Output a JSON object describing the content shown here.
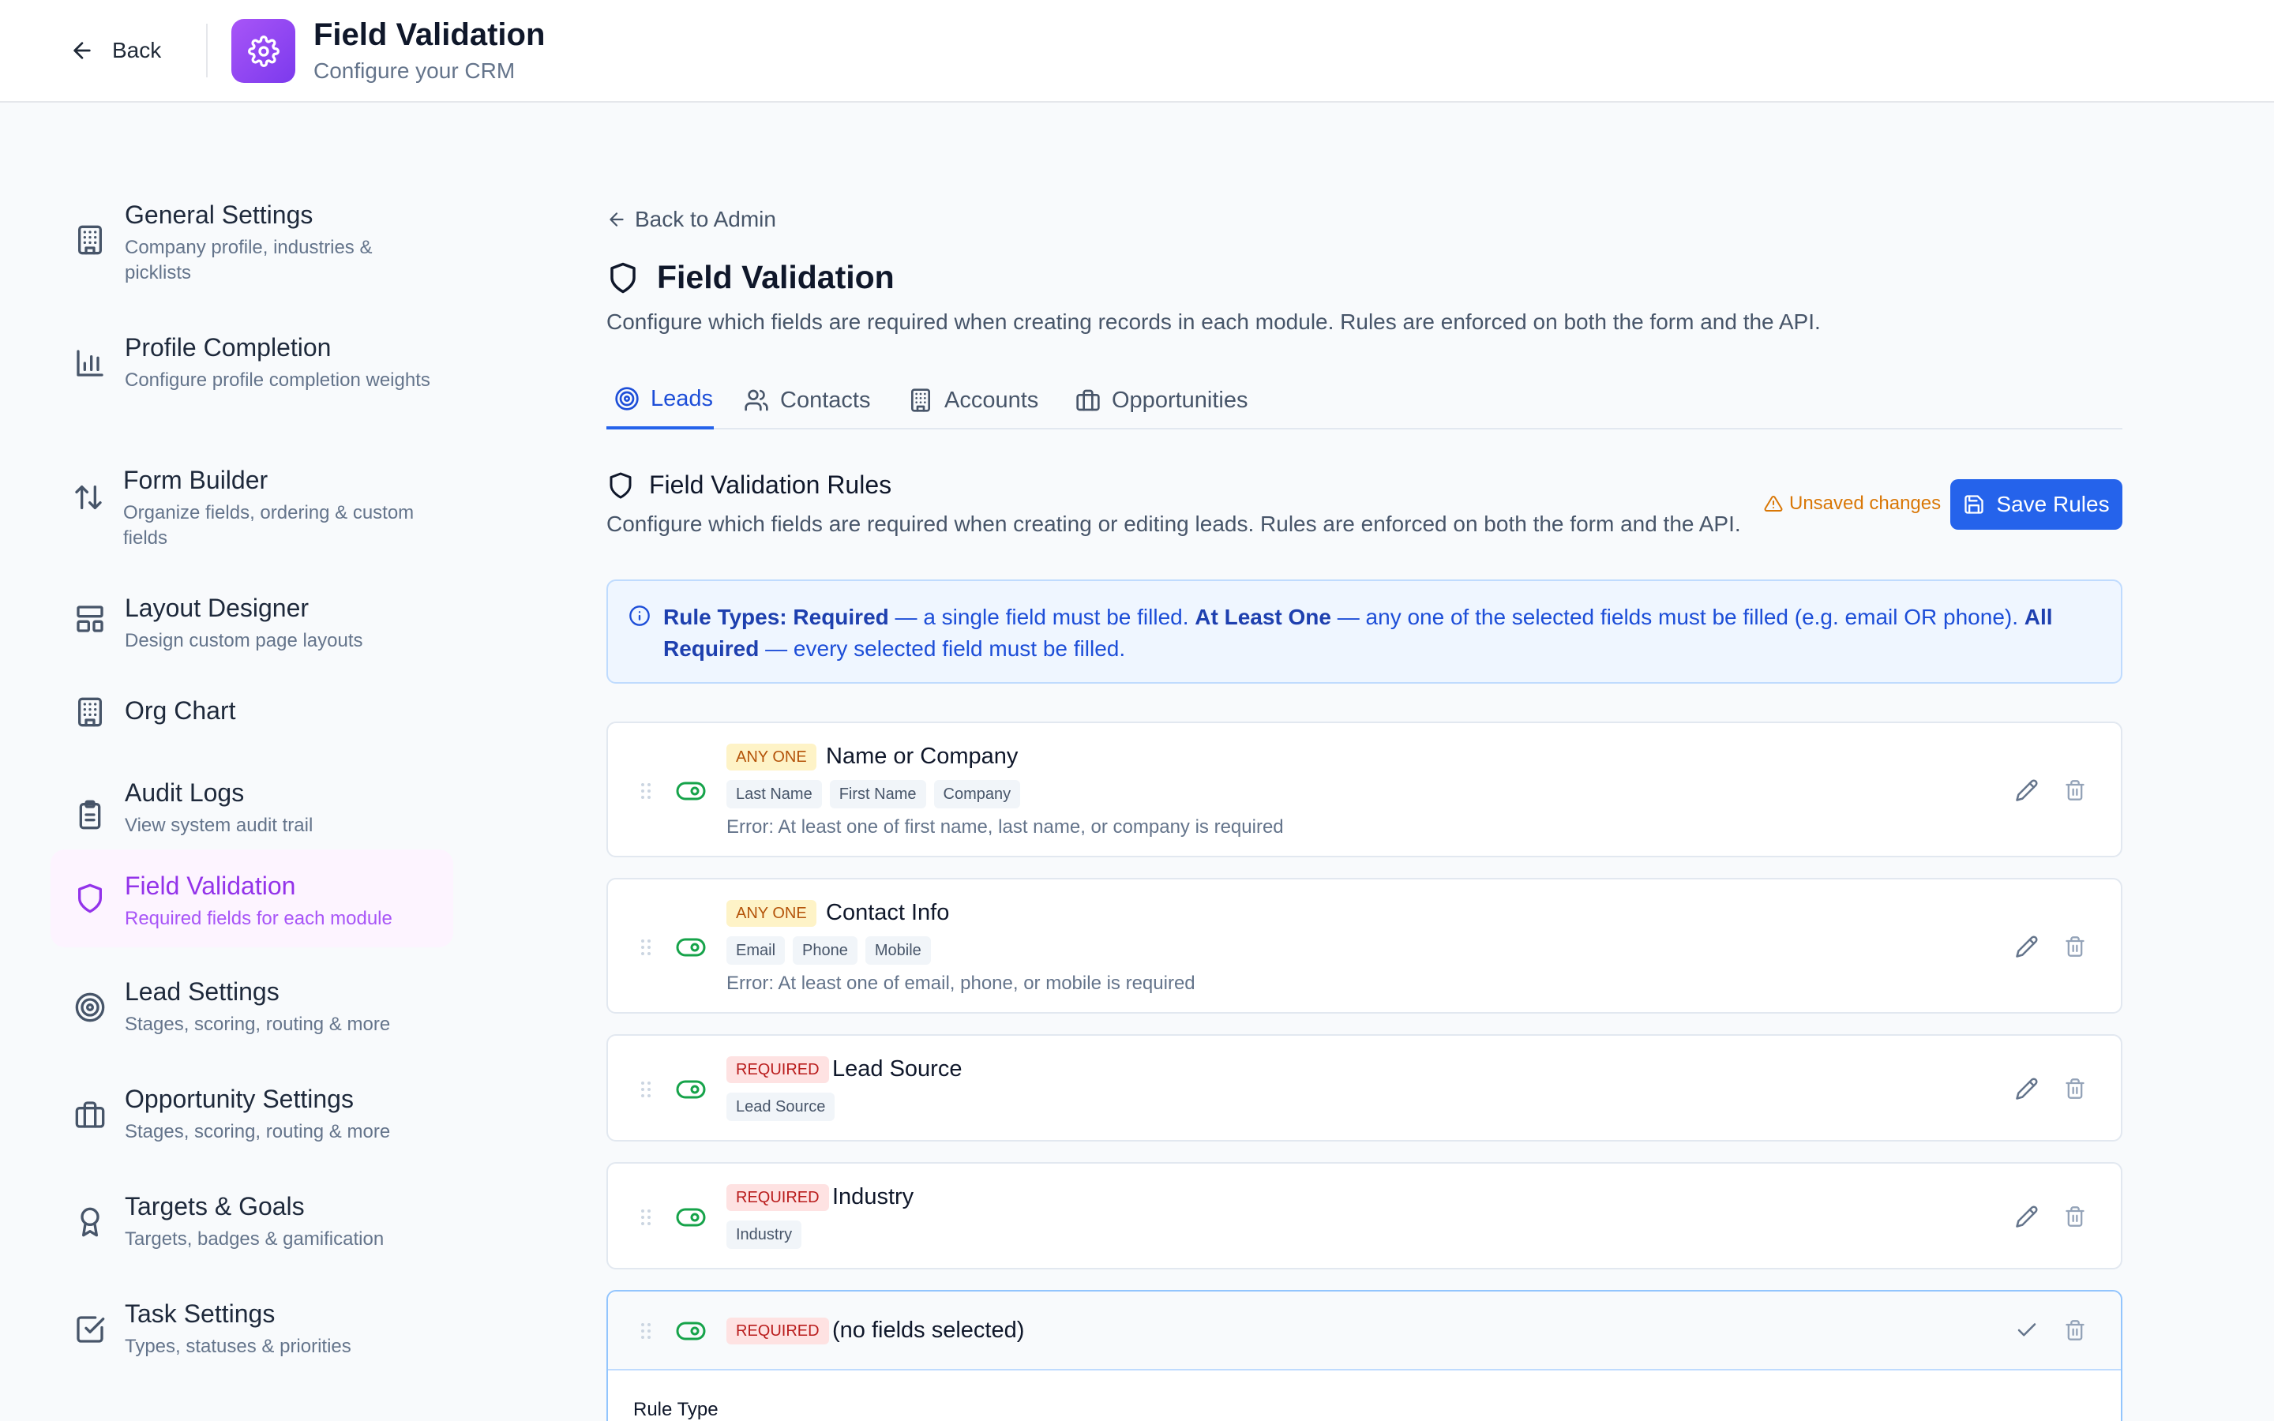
{
  "topbar": {
    "back_label": "Back",
    "title": "Field Validation",
    "subtitle": "Configure your CRM"
  },
  "sidebar": {
    "items": [
      {
        "title": "General Settings",
        "desc": "Company profile, industries & picklists",
        "icon": "building-icon"
      },
      {
        "title": "Profile Completion",
        "desc": "Configure profile completion weights",
        "icon": "bar-chart-icon"
      },
      {
        "title": "Form Builder",
        "desc": "Organize fields, ordering & custom fields",
        "icon": "arrows-up-down-icon"
      },
      {
        "title": "Layout Designer",
        "desc": "Design custom page layouts",
        "icon": "layout-icon"
      },
      {
        "title": "Org Chart",
        "desc": "",
        "icon": "building-icon"
      },
      {
        "title": "Audit Logs",
        "desc": "View system audit trail",
        "icon": "clipboard-icon"
      },
      {
        "title": "Field Validation",
        "desc": "Required fields for each module",
        "icon": "shield-icon",
        "active": true
      },
      {
        "title": "Lead Settings",
        "desc": "Stages, scoring, routing & more",
        "icon": "target-icon"
      },
      {
        "title": "Opportunity Settings",
        "desc": "Stages, scoring, routing & more",
        "icon": "briefcase-icon"
      },
      {
        "title": "Targets & Goals",
        "desc": "Targets, badges & gamification",
        "icon": "award-icon"
      },
      {
        "title": "Task Settings",
        "desc": "Types, statuses & priorities",
        "icon": "check-square-icon"
      }
    ]
  },
  "main": {
    "back_admin": "Back to Admin",
    "title": "Field Validation",
    "description": "Configure which fields are required when creating records in each module. Rules are enforced on both the form and the API.",
    "tabs": [
      {
        "label": "Leads",
        "icon": "target-icon",
        "active": true
      },
      {
        "label": "Contacts",
        "icon": "users-icon"
      },
      {
        "label": "Accounts",
        "icon": "building-icon"
      },
      {
        "label": "Opportunities",
        "icon": "briefcase-icon"
      }
    ],
    "section_title": "Field Validation Rules",
    "section_desc": "Configure which fields are required when creating or editing leads. Rules are enforced on both the form and the API.",
    "unsaved_label": "Unsaved changes",
    "save_label": "Save Rules",
    "info": {
      "t1": "Rule Types:",
      "t2": "Required",
      "t3": " — a single field must be filled. ",
      "t4": "At Least One",
      "t5": " — any one of the selected fields must be filled (e.g. email OR phone). ",
      "t6": "All Required",
      "t7": " — every selected field must be filled."
    },
    "rules": [
      {
        "badge": "ANY ONE",
        "name": "Name or Company",
        "chips": [
          "Last Name",
          "First Name",
          "Company"
        ],
        "error": "Error: At least one of first name, last name, or company is required"
      },
      {
        "badge": "ANY ONE",
        "name": "Contact Info",
        "chips": [
          "Email",
          "Phone",
          "Mobile"
        ],
        "error": "Error: At least one of email, phone, or mobile is required"
      },
      {
        "badge": "REQUIRED",
        "name": "Lead Source",
        "chips": [
          "Lead Source"
        ],
        "error": ""
      },
      {
        "badge": "REQUIRED",
        "name": "Industry",
        "chips": [
          "Industry"
        ],
        "error": ""
      },
      {
        "badge": "REQUIRED",
        "name": "(no fields selected)",
        "chips": [],
        "error": "",
        "editing": true,
        "rule_type_label": "Rule Type"
      }
    ]
  },
  "colors": {
    "accent": "#2563eb",
    "active_nav": "#9333ea",
    "toggle_on": "#16a34a",
    "warning": "#d97706"
  }
}
